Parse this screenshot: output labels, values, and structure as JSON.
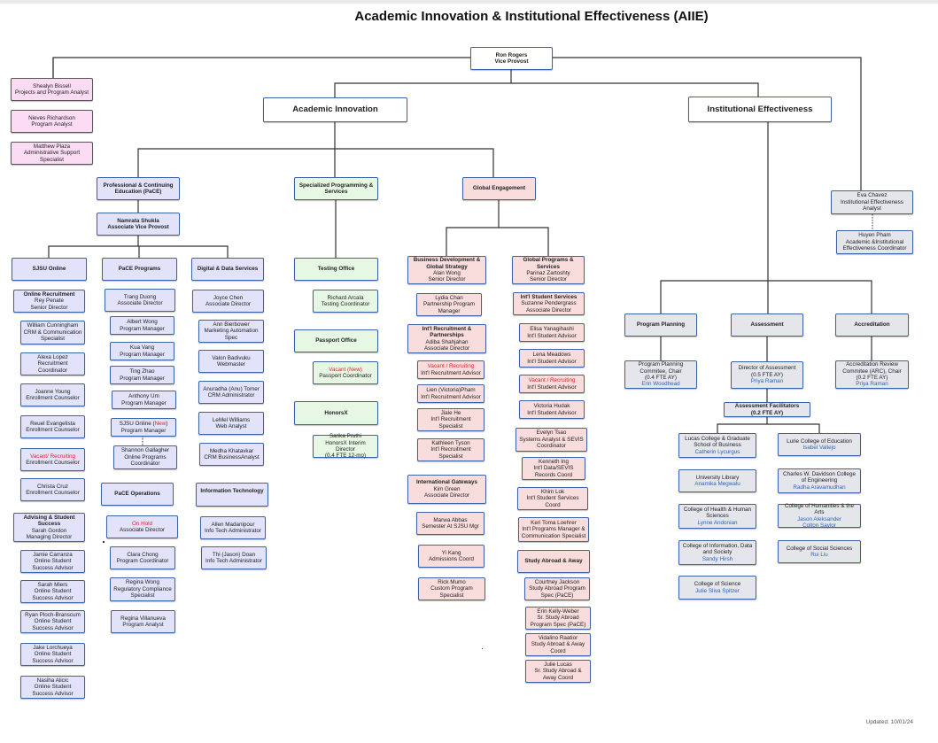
{
  "title": "Academic Innovation & Institutional Effectiveness (AIIE)",
  "updated": "Updated: 10/01/24",
  "top": {
    "name": "Ron Rogers",
    "role": "Vice Provost"
  },
  "staff": [
    {
      "name": "Shealyn Bissell",
      "role": "Projects and Program Analyst"
    },
    {
      "name": "Nieves Richardson",
      "role": "Program Analyst"
    },
    {
      "name": "Matthew Plaza",
      "role": "Administrative Support Specialist"
    }
  ],
  "divisions": {
    "academic_innovation": "Academic Innovation",
    "institutional_effectiveness": "Institutional Effectiveness"
  },
  "pace": {
    "header": "Professional & Continuing Education (PaCE)",
    "avp": {
      "name": "Namrata Shukla",
      "role": "Associate Vice Provost"
    },
    "sjsu_online": {
      "header": "SJSU Online",
      "online_recruitment": {
        "unit": "Online Recruitment",
        "name": "Rey Penate",
        "role": "Senior Director"
      },
      "recruitment_staff": [
        {
          "name": "William Cunningham",
          "role": "CRM & Communication Specialist"
        },
        {
          "name": "Alexa Lopez",
          "role": "Recruitment Coordinator"
        },
        {
          "name": "Joanne Young",
          "role": "Enrollment Counselor"
        },
        {
          "name": "Reuel Evangelista",
          "role": "Enrollment Counselor"
        },
        {
          "name": "Vacant/ Recruiting",
          "role": "Enrollment Counselor",
          "status": "vacant"
        },
        {
          "name": "Christa Cruz",
          "role": "Enrollment Counselor"
        }
      ],
      "advising": {
        "unit": "Advising & Student Success",
        "name": "Sarah Gordon",
        "role": "Managing Director"
      },
      "advising_staff": [
        {
          "name": "Jamie Carranza",
          "role": "Online Student Success Advisor"
        },
        {
          "name": "Sarah Miers",
          "role": "Online Student Success Advisor"
        },
        {
          "name": "Ryan Ploch-Branscum",
          "role": "Online Student Success Advisor"
        },
        {
          "name": "Jake Lorchueya",
          "role": "Online Student Success Advisor"
        },
        {
          "name": "Nasiha Alicic",
          "role": "Online Student Success Advisor"
        }
      ]
    },
    "pace_programs": {
      "header": "PaCE Programs",
      "staff": [
        {
          "name": "Trang Duong",
          "role": "Associate Director"
        },
        {
          "name": "Albert Wong",
          "role": "Program Manager"
        },
        {
          "name": "Kua Vang",
          "role": "Program Manager"
        },
        {
          "name": "Ting Zhao",
          "role": "Program Manager"
        },
        {
          "name": "Anthony Um",
          "role": "Program Manager"
        }
      ],
      "sjsu_online_pm": {
        "prefix": "SJSU Online (",
        "flag": "New",
        "suffix": ")",
        "role": "Program Manager"
      },
      "shannon": {
        "name": "Shannon Gallagher",
        "role": "Online Programs Coordinator"
      }
    },
    "pace_operations": {
      "header": "PaCE Operations",
      "on_hold": {
        "name": "On Hold",
        "role": "Associate Director",
        "status": "on-hold"
      },
      "staff": [
        {
          "name": "Clara Chong",
          "role": "Program Coordinator"
        },
        {
          "name": "Regina Wong",
          "role": "Regulatory Compliance Specialist"
        },
        {
          "name": "Regina Villanueva",
          "role": "Program Analyst"
        }
      ]
    },
    "digital_data": {
      "header": "Digital & Data Services",
      "staff": [
        {
          "name": "Joyce Chen",
          "role": "Associate Director"
        },
        {
          "name": "Ann Bierbower",
          "role": "Marketing Automation Spec"
        },
        {
          "name": "Valon Badivuku",
          "role": "Webmaster"
        },
        {
          "name": "Anuradha (Anu) Tomer",
          "role": "CRM Administrator"
        },
        {
          "name": "LeMel Williams",
          "role": "Web Analyst"
        },
        {
          "name": "Medha Khatavkar",
          "role": "CRM BusinessAnalyst"
        }
      ]
    },
    "info_tech": {
      "header": "Information Technology",
      "staff": [
        {
          "name": "Allen Madanipour",
          "role": "Info Tech Administrator"
        },
        {
          "name": "Thi (Jason) Doan",
          "role": "Info Tech Administrator"
        }
      ]
    }
  },
  "specialized": {
    "header": "Specialized Programming & Services",
    "testing": {
      "header": "Testing Office",
      "staff": {
        "name": "Richard Arcala",
        "role": "Testing Coordinator"
      }
    },
    "passport": {
      "header": "Passport Office",
      "staff": {
        "name": "Vacant (New)",
        "role": "Passport Coordinator",
        "status": "vacant"
      }
    },
    "honorsx": {
      "header": "HonorsX",
      "staff": {
        "name": "Sarika Pruthi",
        "role": "HonorsX Interim Director",
        "note": "(0.4 FTE 12-mo)"
      }
    }
  },
  "global": {
    "header": "Global Engagement",
    "bizdev": {
      "unit": "Business Development & Global Strategy",
      "name": "Alan Wong",
      "role": "Senior Director"
    },
    "lydia": {
      "name": "Lydia Chan",
      "role": "Partnership Program Manager"
    },
    "recruitment": {
      "unit": "Int'l Recruitment & Partnerships",
      "name": "Adiba Shahjahan",
      "role": "Associate Director"
    },
    "recruitment_staff": [
      {
        "name": "Vacant / Recruiting",
        "role": "Int'l Recruitment Advisor",
        "status": "vacant"
      },
      {
        "name": "Lien (Victoria)Pham",
        "role": "Int'l Recruitment Advisor"
      },
      {
        "name": "Jiale He",
        "role": "Int'l Recruitment Specialist"
      },
      {
        "name": "Kathleen Tyson",
        "role": "Int'l Recruitment Specialist"
      }
    ],
    "gateways": {
      "unit": "International Gateways",
      "name": "Kim Green",
      "role": "Associate Director"
    },
    "gateways_staff": [
      {
        "name": "Marwa Abbas",
        "role": "Semester At SJSU Mgr"
      },
      {
        "name": "Yi Kang",
        "role": "Admissions Coord"
      },
      {
        "name": "Rick Mumo",
        "role": "Custom Program Specialist"
      }
    ],
    "global_programs": {
      "unit": "Global Programs & Services",
      "name": "Parinaz Zartoshty",
      "role": "Senior Director"
    },
    "student_services": {
      "unit": "Int'l Student Services",
      "name": "Suzanne Pendergrass",
      "role": "Associate Director"
    },
    "student_services_staff": [
      {
        "name": "Elisa Yanagihashi",
        "role": "Int'l Student Advisor"
      },
      {
        "name": "Lena Meadows",
        "role": "Int'l Student Advisor"
      },
      {
        "name": "Vacant / Recruiting",
        "role": "Int'l Student Advisor",
        "status": "vacant"
      },
      {
        "name": "Victoria Hudak",
        "role": "Int'l Student Advisor"
      },
      {
        "name": "Evelyn Tsao",
        "role": "Systems Analyst & SEVIS Coordinator"
      },
      {
        "name": "Kenneth Ing",
        "role": "Int'l Data/SEVIS Records Coord"
      },
      {
        "name": "Khim Lok",
        "role": "Int'l Student Services Coord"
      },
      {
        "name": "Keri Toma Loehrer",
        "role": "Int'l Programs Manager & Communication Specialist"
      }
    ],
    "study_abroad": {
      "header": "Study Abroad & Away"
    },
    "study_abroad_staff": [
      {
        "name": "Courtney Jackson",
        "role": "Study Abroad Program Spec (PaCE)"
      },
      {
        "name": "Erin Kelly-Weber",
        "role": "Sr. Study Abroad Program Spec (PaCE)"
      },
      {
        "name": "Vidalino Raatior",
        "role": "Study Abroad & Away Coord"
      },
      {
        "name": "Julie Lucas",
        "role": "Sr. Study Abroad & Away Coord"
      }
    ]
  },
  "ie": {
    "eva": {
      "name": "Eva Chavez",
      "role": "Institutional Effectiveness Analyst"
    },
    "huyen": {
      "name": "Huyen Pham",
      "role": "Academic &Institutional Effectiveness Coordinator"
    },
    "program_planning": {
      "header": "Program Planning",
      "chair": {
        "title": "Program Planning Commitee, Chair",
        "fte": "(0.4 FTE AY)",
        "name": "Erin Woodhead"
      }
    },
    "assessment": {
      "header": "Assessment",
      "director": {
        "title": "Director of Assessment",
        "fte": "(0.5 FTE AY)",
        "name": "Priya Raman"
      }
    },
    "accreditation": {
      "header": "Accreditation",
      "chair": {
        "title": "Accreditation Review Commitee (ARC), Chair",
        "fte": "(0.2 FTE AY)",
        "name": "Priya Raman"
      }
    },
    "facilitators": {
      "title": "Assessment Facilitators",
      "fte": "(0.2 FTE AY)"
    },
    "colleges_left": [
      {
        "college": "Lucas College & Graduate School of Business",
        "names": [
          "Catherin Lycurgus"
        ]
      },
      {
        "college": "University Library",
        "names": [
          "Anamika Megwalu"
        ]
      },
      {
        "college": "College of Health & Human Sciences",
        "names": [
          "Lynne Andonian"
        ]
      },
      {
        "college": "College of Information, Data and Society",
        "names": [
          "Sandy Hirsh"
        ]
      },
      {
        "college": "College of Science",
        "names": [
          "Julie Sliva Spitzer"
        ]
      }
    ],
    "colleges_right": [
      {
        "college": "Lurie College of Education",
        "names": [
          "Isabel Vallejo"
        ]
      },
      {
        "college": "Charles W. Davidson College of Engineering",
        "names": [
          "Radha Aravamudhan"
        ]
      },
      {
        "college": "College of Humanities & the Arts",
        "names": [
          "Jason Aleksander",
          "Colton Saylor"
        ]
      },
      {
        "college": "College of Social Sciences",
        "names": [
          "Rui Liu"
        ]
      }
    ]
  }
}
